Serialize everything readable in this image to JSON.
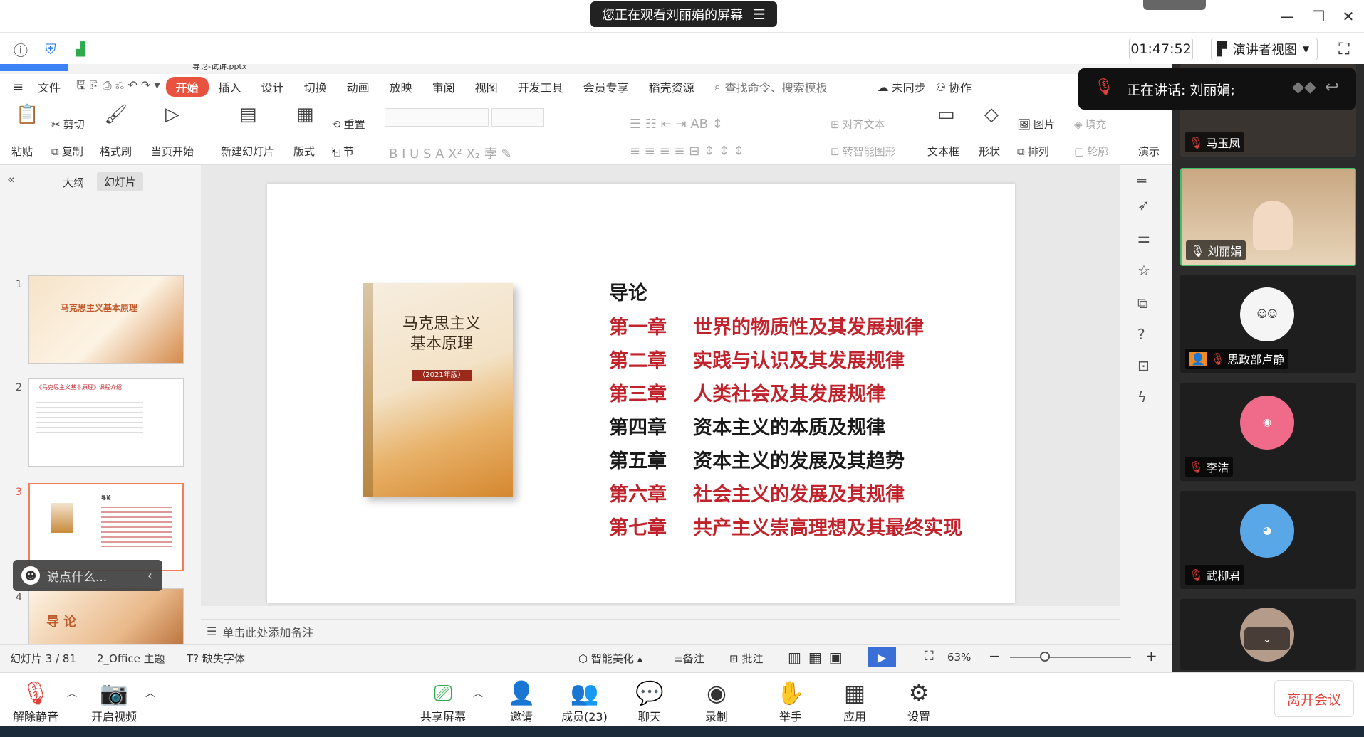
{
  "top": {
    "share_banner": "您正在观看刘丽娟的屏幕",
    "timer": "01:47:52",
    "view_mode": "演讲者视图"
  },
  "speaking": "正在讲话: 刘丽娟;",
  "ppt": {
    "file_tab": "导论-试讲.pptx",
    "ribbon_tabs": [
      "文件",
      "开始",
      "插入",
      "设计",
      "切换",
      "动画",
      "放映",
      "审阅",
      "视图",
      "开发工具",
      "会员专享",
      "稻壳资源"
    ],
    "search_placeholder": "查找命令、搜索模板",
    "sync": "未同步",
    "collab": "协作",
    "ribbon": {
      "paste": "粘贴",
      "cut": "剪切",
      "copy": "复制",
      "format_painter": "格式刷",
      "from_current": "当页开始",
      "new_slide": "新建幻灯片",
      "layout": "版式",
      "section": "节",
      "reset": "重置",
      "align_text": "对齐文本",
      "smart_art": "转智能图形",
      "textbox": "文本框",
      "shape": "形状",
      "picture": "图片",
      "arrange": "排列",
      "fill": "填充",
      "outline": "轮廓",
      "present": "演示"
    },
    "pane_tabs": [
      "大纲",
      "幻灯片"
    ],
    "thumbs": [
      {
        "num": "1",
        "title": "马克思主义基本原理"
      },
      {
        "num": "2",
        "title": "《马克思主义基本原理》课程介绍"
      },
      {
        "num": "3",
        "title": "导论"
      },
      {
        "num": "4",
        "title": "导 论"
      }
    ],
    "chat_placeholder": "说点什么...",
    "slide": {
      "heading": "导论",
      "book_title": "马克思主义基本原理",
      "book_edition": "（2021年版）",
      "chapters": [
        {
          "num": "第一章",
          "title": "世界的物质性及其发展规律",
          "color": "#c0232c"
        },
        {
          "num": "第二章",
          "title": "实践与认识及其发展规律",
          "color": "#c0232c"
        },
        {
          "num": "第三章",
          "title": "人类社会及其发展规律",
          "color": "#c0232c"
        },
        {
          "num": "第四章",
          "title": "资本主义的本质及规律",
          "color": "#1a1a1a"
        },
        {
          "num": "第五章",
          "title": "资本主义的发展及其趋势",
          "color": "#1a1a1a"
        },
        {
          "num": "第六章",
          "title": "社会主义的发展及其规律",
          "color": "#c0232c"
        },
        {
          "num": "第七章",
          "title": "共产主义崇高理想及其最终实现",
          "color": "#c0232c"
        }
      ]
    },
    "notes_placeholder": "单击此处添加备注",
    "status": {
      "slide_count": "幻灯片 3 / 81",
      "theme": "2_Office 主题",
      "missing_font": "缺失字体",
      "beautify": "智能美化",
      "notes": "备注",
      "comment": "批注",
      "zoom": "63%"
    }
  },
  "participants": [
    {
      "name": "马玉凤",
      "color": "#8a6d5a"
    },
    {
      "name": "刘丽娟",
      "color": "#c9a883"
    },
    {
      "name": "思政部卢静",
      "color": "#f5f5f5"
    },
    {
      "name": "李洁",
      "color": "#f06b8a"
    },
    {
      "name": "武柳君",
      "color": "#5aa7e8"
    }
  ],
  "toolbar": {
    "unmute": "解除静音",
    "video": "开启视频",
    "share": "共享屏幕",
    "invite": "邀请",
    "members": "成员(23)",
    "chat": "聊天",
    "record": "录制",
    "raise_hand": "举手",
    "apps": "应用",
    "settings": "设置",
    "leave": "离开会议"
  }
}
